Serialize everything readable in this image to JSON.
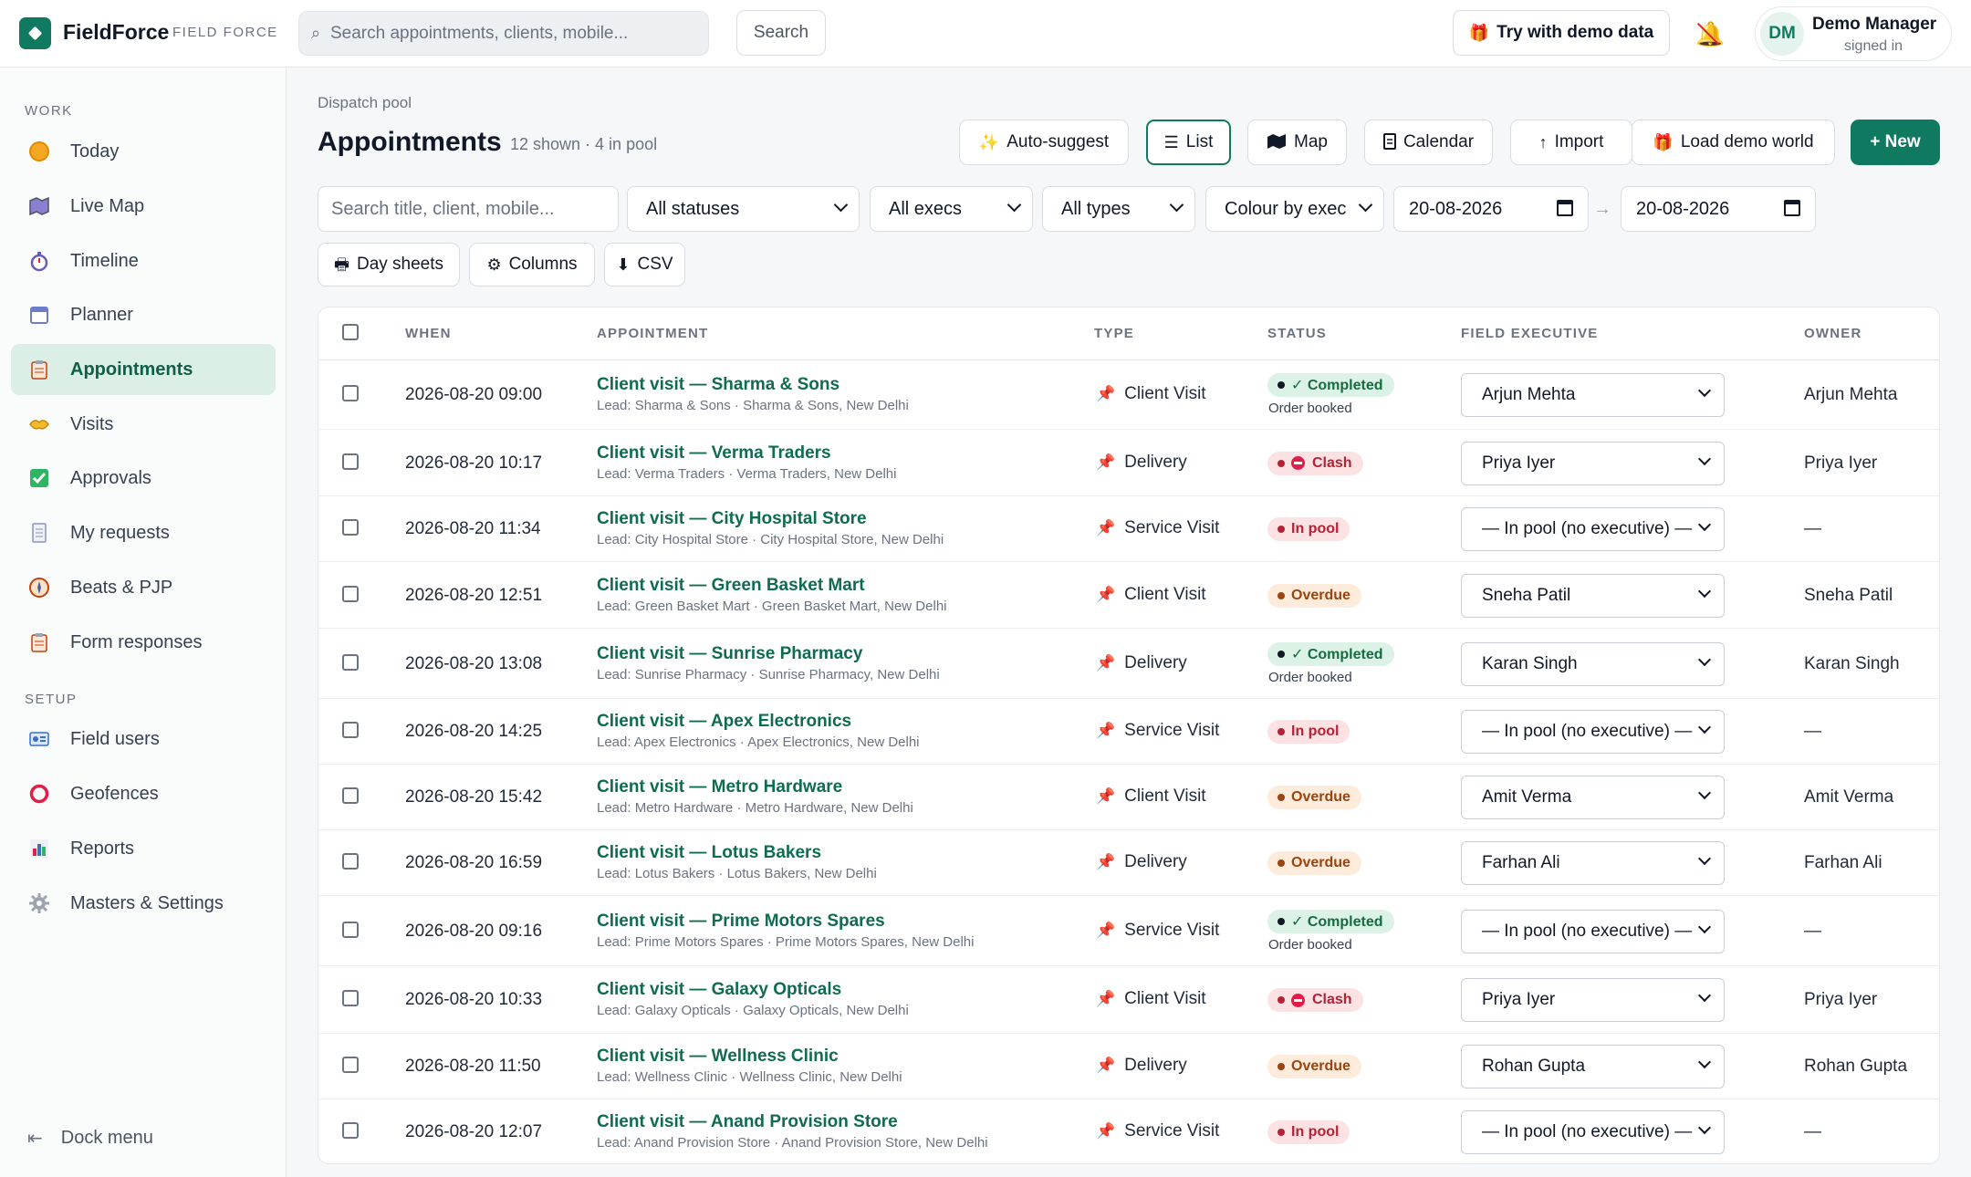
{
  "app": {
    "name": "FieldForce",
    "subtitle": "FIELD FORCE",
    "search_placeholder": "Search appointments, clients, mobile...",
    "search_button": "Search",
    "demo_button": "Try with demo data",
    "user_initials": "DM",
    "user_name": "Demo Manager",
    "user_status": "signed in"
  },
  "sidebar": {
    "sections": [
      {
        "title": "WORK",
        "items": [
          {
            "label": "Today",
            "icon": "sun-icon"
          },
          {
            "label": "Live Map",
            "icon": "map-icon"
          },
          {
            "label": "Timeline",
            "icon": "stopwatch-icon"
          },
          {
            "label": "Planner",
            "icon": "calendar-icon"
          },
          {
            "label": "Appointments",
            "icon": "clipboard-icon",
            "active": true
          },
          {
            "label": "Visits",
            "icon": "handshake-icon"
          },
          {
            "label": "Approvals",
            "icon": "check-box-icon"
          },
          {
            "label": "My requests",
            "icon": "receipt-icon"
          },
          {
            "label": "Beats & PJP",
            "icon": "compass-icon"
          },
          {
            "label": "Form responses",
            "icon": "clipboard-icon"
          }
        ]
      },
      {
        "title": "SETUP",
        "items": [
          {
            "label": "Field users",
            "icon": "id-card-icon"
          },
          {
            "label": "Geofences",
            "icon": "ring-icon"
          },
          {
            "label": "Reports",
            "icon": "bar-chart-icon"
          },
          {
            "label": "Masters & Settings",
            "icon": "gear-icon"
          }
        ]
      }
    ],
    "dock_label": "Dock menu"
  },
  "page": {
    "breadcrumb": "Dispatch pool",
    "title": "Appointments",
    "meta": "12 shown · 4 in pool",
    "actions": {
      "auto_suggest": "Auto-suggest",
      "list": "List",
      "map": "Map",
      "calendar": "Calendar",
      "import": "Import",
      "load_demo": "Load demo world",
      "new": "+ New"
    }
  },
  "filters": {
    "search_placeholder": "Search title, client, mobile...",
    "status": "All statuses",
    "exec": "All execs",
    "type": "All types",
    "colour": "Colour by exec",
    "date_from": "20-08-2026",
    "date_arrow": "→",
    "date_to": "20-08-2026",
    "day_sheets": "Day sheets",
    "columns": "Columns",
    "csv": "CSV"
  },
  "table": {
    "headers": {
      "when": "WHEN",
      "appointment": "APPOINTMENT",
      "type": "TYPE",
      "status": "STATUS",
      "exec": "FIELD EXECUTIVE",
      "owner": "OWNER"
    },
    "rows": [
      {
        "when": "2026-08-20 09:00",
        "title": "Client visit — Sharma & Sons",
        "sub": "Lead: Sharma & Sons · Sharma & Sons, New Delhi",
        "type": "Client Visit",
        "status": "✓ Completed",
        "status_kind": "completed",
        "note": "Order booked",
        "exec": "Arjun Mehta",
        "owner": "Arjun Mehta"
      },
      {
        "when": "2026-08-20 10:17",
        "title": "Client visit — Verma Traders",
        "sub": "Lead: Verma Traders · Verma Traders, New Delhi",
        "type": "Delivery",
        "status": "Clash",
        "status_kind": "clash",
        "note": "",
        "exec": "Priya Iyer",
        "owner": "Priya Iyer"
      },
      {
        "when": "2026-08-20 11:34",
        "title": "Client visit — City Hospital Store",
        "sub": "Lead: City Hospital Store · City Hospital Store, New Delhi",
        "type": "Service Visit",
        "status": "In pool",
        "status_kind": "pool",
        "note": "",
        "exec": "— In pool (no executive) —",
        "owner": "—"
      },
      {
        "when": "2026-08-20 12:51",
        "title": "Client visit — Green Basket Mart",
        "sub": "Lead: Green Basket Mart · Green Basket Mart, New Delhi",
        "type": "Client Visit",
        "status": "Overdue",
        "status_kind": "overdue",
        "note": "",
        "exec": "Sneha Patil",
        "owner": "Sneha Patil"
      },
      {
        "when": "2026-08-20 13:08",
        "title": "Client visit — Sunrise Pharmacy",
        "sub": "Lead: Sunrise Pharmacy · Sunrise Pharmacy, New Delhi",
        "type": "Delivery",
        "status": "✓ Completed",
        "status_kind": "completed",
        "note": "Order booked",
        "exec": "Karan Singh",
        "owner": "Karan Singh"
      },
      {
        "when": "2026-08-20 14:25",
        "title": "Client visit — Apex Electronics",
        "sub": "Lead: Apex Electronics · Apex Electronics, New Delhi",
        "type": "Service Visit",
        "status": "In pool",
        "status_kind": "pool",
        "note": "",
        "exec": "— In pool (no executive) —",
        "owner": "—"
      },
      {
        "when": "2026-08-20 15:42",
        "title": "Client visit — Metro Hardware",
        "sub": "Lead: Metro Hardware · Metro Hardware, New Delhi",
        "type": "Client Visit",
        "status": "Overdue",
        "status_kind": "overdue",
        "note": "",
        "exec": "Amit Verma",
        "owner": "Amit Verma"
      },
      {
        "when": "2026-08-20 16:59",
        "title": "Client visit — Lotus Bakers",
        "sub": "Lead: Lotus Bakers · Lotus Bakers, New Delhi",
        "type": "Delivery",
        "status": "Overdue",
        "status_kind": "overdue",
        "note": "",
        "exec": "Farhan Ali",
        "owner": "Farhan Ali"
      },
      {
        "when": "2026-08-20 09:16",
        "title": "Client visit — Prime Motors Spares",
        "sub": "Lead: Prime Motors Spares · Prime Motors Spares, New Delhi",
        "type": "Service Visit",
        "status": "✓ Completed",
        "status_kind": "completed",
        "note": "Order booked",
        "exec": "— In pool (no executive) —",
        "owner": "—"
      },
      {
        "when": "2026-08-20 10:33",
        "title": "Client visit — Galaxy Opticals",
        "sub": "Lead: Galaxy Opticals · Galaxy Opticals, New Delhi",
        "type": "Client Visit",
        "status": "Clash",
        "status_kind": "clash",
        "note": "",
        "exec": "Priya Iyer",
        "owner": "Priya Iyer"
      },
      {
        "when": "2026-08-20 11:50",
        "title": "Client visit — Wellness Clinic",
        "sub": "Lead: Wellness Clinic · Wellness Clinic, New Delhi",
        "type": "Delivery",
        "status": "Overdue",
        "status_kind": "overdue",
        "note": "",
        "exec": "Rohan Gupta",
        "owner": "Rohan Gupta"
      },
      {
        "when": "2026-08-20 12:07",
        "title": "Client visit — Anand Provision Store",
        "sub": "Lead: Anand Provision Store · Anand Provision Store, New Delhi",
        "type": "Service Visit",
        "status": "In pool",
        "status_kind": "pool",
        "note": "",
        "exec": "— In pool (no executive) —",
        "owner": "—"
      }
    ]
  },
  "colors": {
    "brand": "#0f7a5f",
    "completed": "#146c3f",
    "clash": "#b42335",
    "overdue": "#9a4410"
  }
}
